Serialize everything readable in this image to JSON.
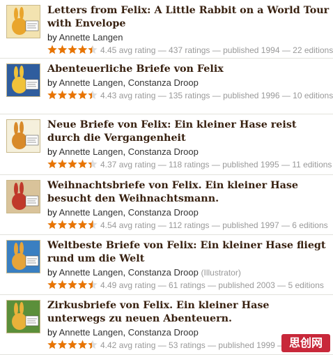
{
  "colors": {
    "star": "#e87400",
    "title": "#382110",
    "meta": "#999999",
    "divider": "#e2e2dc"
  },
  "books": [
    {
      "title": "Letters from Felix: A Little Rabbit on a World Tour with Envelope",
      "by": "by",
      "authors": [
        "Annette Langen"
      ],
      "role": "",
      "rating": 4.45,
      "meta": "4.45 avg rating — 437 ratings — published 1994 — 22 editions",
      "cover_icon": "rabbit-cover-icon"
    },
    {
      "title": "Abenteuerliche Briefe von Felix",
      "by": "by",
      "authors": [
        "Annette Langen",
        "Constanza Droop"
      ],
      "role": "",
      "rating": 4.43,
      "meta": "4.43 avg rating — 135 ratings — published 1996 — 10 editions",
      "cover_icon": "rabbit-cover-icon"
    },
    {
      "title": "Neue Briefe von Felix: Ein kleiner Hase reist durch die Vergangenheit",
      "by": "by",
      "authors": [
        "Annette Langen",
        "Constanza Droop"
      ],
      "role": "",
      "rating": 4.37,
      "meta": "4.37 avg rating — 118 ratings — published 1995 — 11 editions",
      "cover_icon": "rabbit-cover-icon"
    },
    {
      "title": "Weihnachtsbriefe von Felix. Ein kleiner Hase besucht den Weihnachtsmann.",
      "by": "by",
      "authors": [
        "Annette Langen",
        "Constanza Droop"
      ],
      "role": "",
      "rating": 4.54,
      "meta": "4.54 avg rating — 112 ratings — published 1997 — 6 editions",
      "cover_icon": "rabbit-cover-icon"
    },
    {
      "title": "Weltbeste Briefe von Felix: Ein kleiner Hase fliegt rund um die Welt",
      "by": "by",
      "authors": [
        "Annette Langen",
        "Constanza Droop"
      ],
      "role": "(Illustrator)",
      "rating": 4.49,
      "meta": "4.49 avg rating — 61 ratings — published 2003 — 5 editions",
      "cover_icon": "rabbit-cover-icon"
    },
    {
      "title": "Zirkusbriefe von Felix. Ein kleiner Hase unterwegs zu neuen Abenteuern.",
      "by": "by",
      "authors": [
        "Annette Langen",
        "Constanza Droop"
      ],
      "role": "",
      "rating": 4.42,
      "meta": "4.42 avg rating — 53 ratings — published 1999 — ",
      "cover_icon": "rabbit-cover-icon"
    }
  ],
  "watermark": {
    "text": "思创网"
  }
}
